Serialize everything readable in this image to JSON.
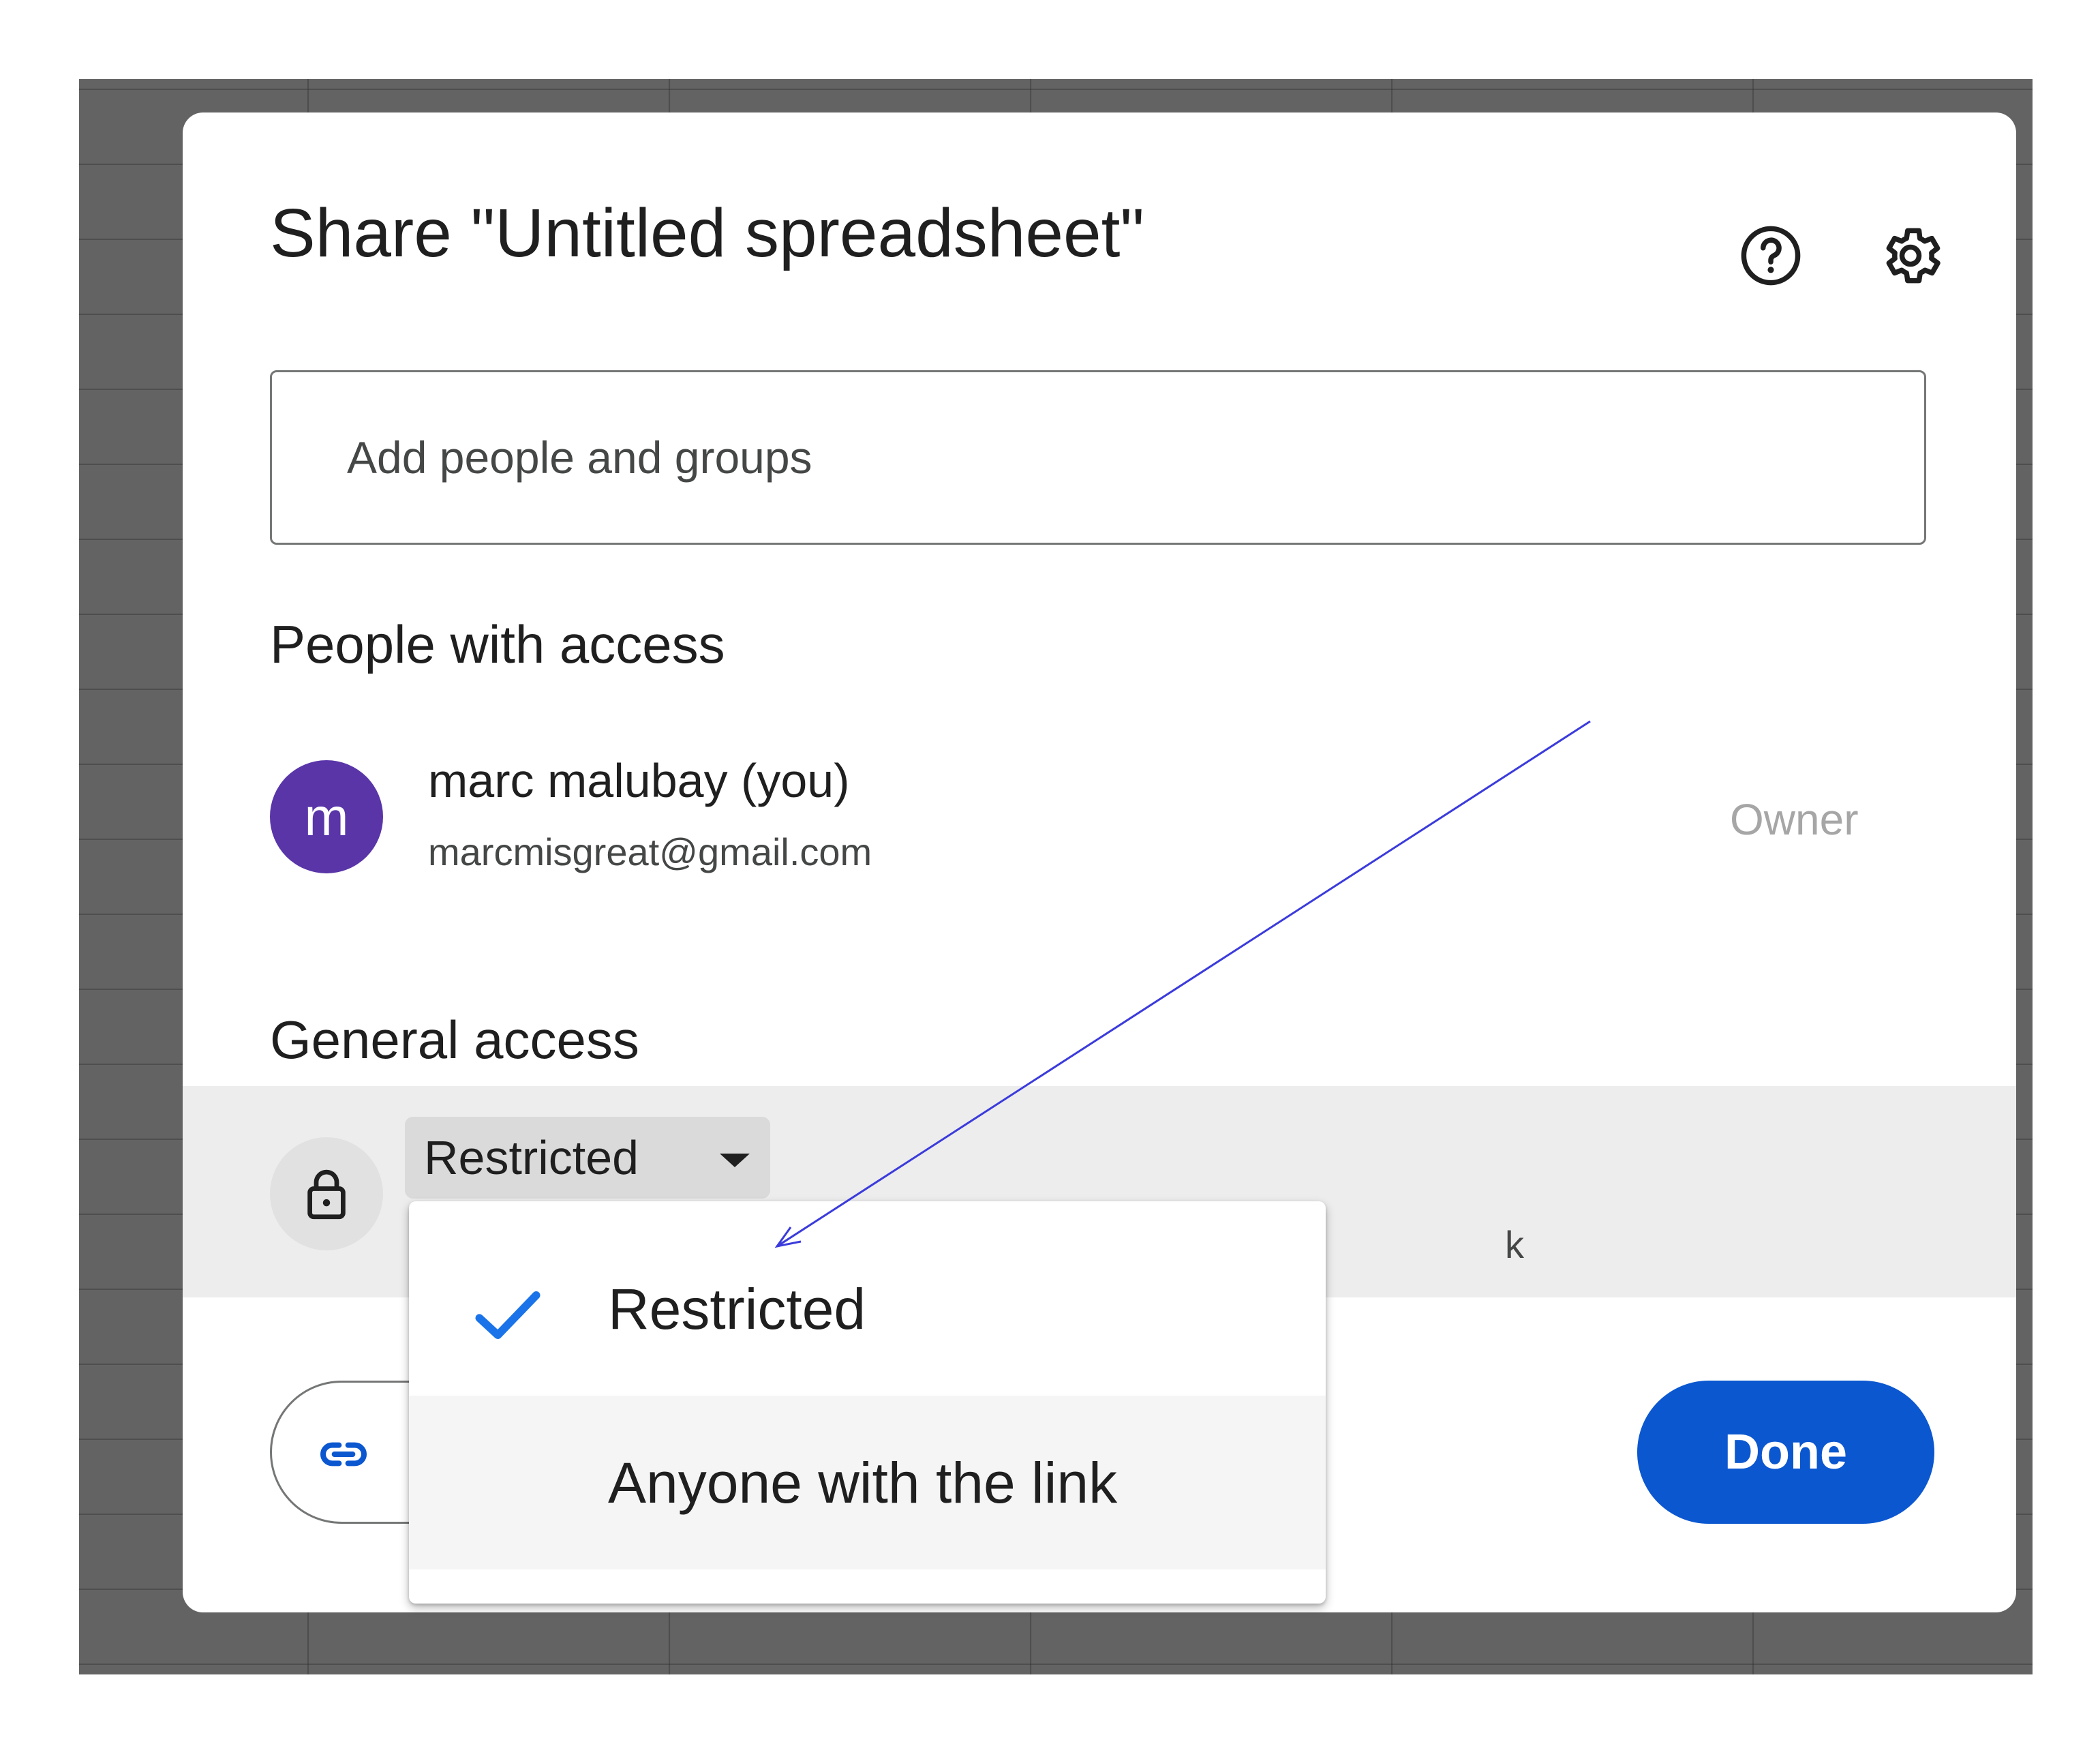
{
  "dialog": {
    "title": "Share \"Untitled spreadsheet\"",
    "help_icon": "help-circle-icon",
    "settings_icon": "gear-icon"
  },
  "add_people": {
    "placeholder": "Add people and groups",
    "value": ""
  },
  "people_with_access": {
    "heading": "People with access",
    "people": [
      {
        "avatar_letter": "m",
        "avatar_color": "#5935a8",
        "name": "marc malubay (you)",
        "email": "marcmisgreat@gmail.com",
        "role": "Owner"
      }
    ]
  },
  "general_access": {
    "heading": "General access",
    "icon": "lock-icon",
    "selected": "Restricted",
    "description_visible": "k",
    "menu": {
      "items": [
        {
          "label": "Restricted",
          "checked": true
        },
        {
          "label": "Anyone with the link",
          "checked": false
        }
      ]
    }
  },
  "footer": {
    "copy_link_icon": "link-icon",
    "done_label": "Done"
  },
  "colors": {
    "primary": "#0b57d0",
    "check": "#1a73e8",
    "annotation_arrow": "#3b3bdc"
  }
}
